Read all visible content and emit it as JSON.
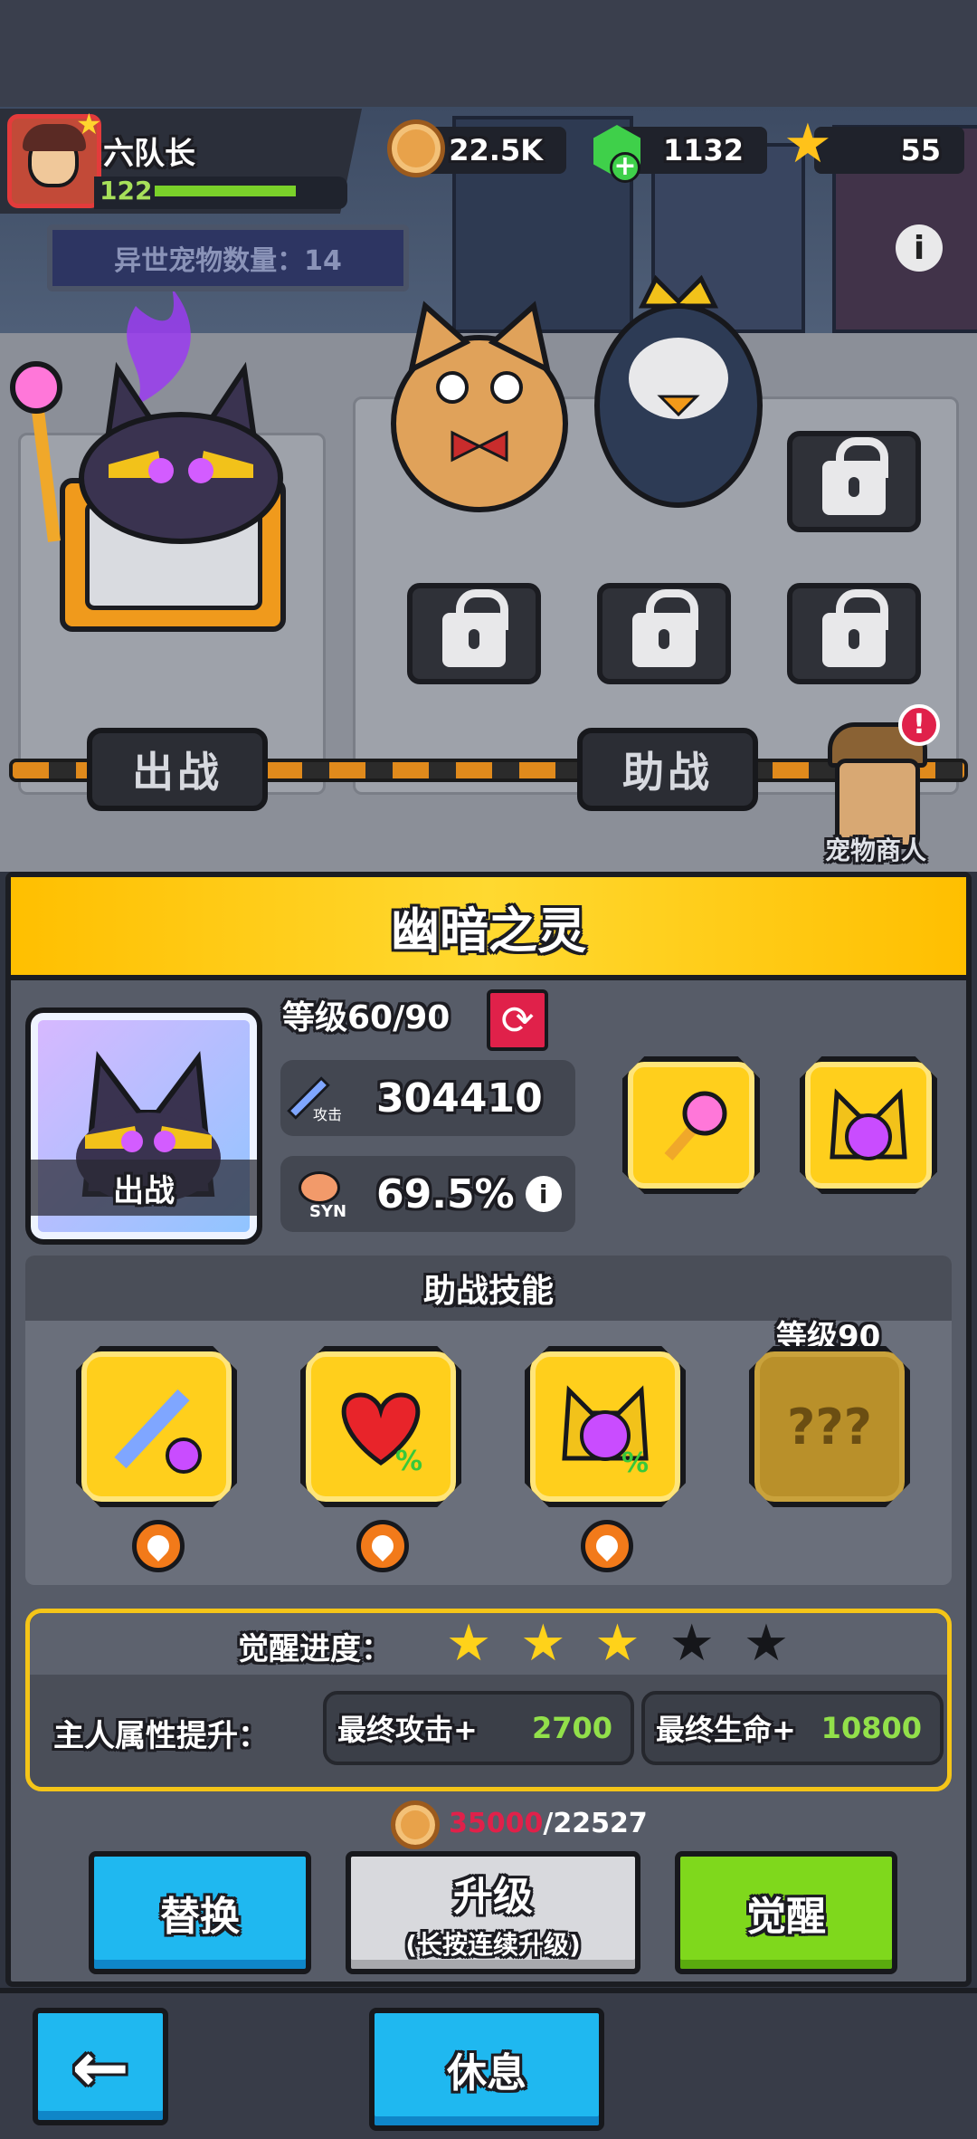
{
  "player": {
    "name": "六队长",
    "level": "122",
    "xp_fraction": 0.85
  },
  "resources": {
    "coins": "22.5K",
    "gems": "1132",
    "stars": "55"
  },
  "scene": {
    "pet_count_label": "异世宠物数量：14",
    "battle_sign": "出战",
    "assist_sign": "助战",
    "merchant_label": "宠物商人"
  },
  "pet": {
    "name": "幽暗之灵",
    "level_text": "等级60/90",
    "state_label": "出战",
    "attack_label": "攻击",
    "attack": "304410",
    "syn_label": "SYN",
    "synergy": "69.5%"
  },
  "skills": {
    "title": "助战技能",
    "locked_level": "等级90",
    "locked_text": "???"
  },
  "awaken": {
    "progress_label": "觉醒进度：",
    "stars_filled": 3,
    "stars_total": 5,
    "owner_label": "主人属性提升：",
    "attack_bonus_label": "最终攻击+",
    "attack_bonus": "2700",
    "hp_bonus_label": "最终生命+",
    "hp_bonus": "10800"
  },
  "cost": {
    "required": "35000",
    "owned": "/22527"
  },
  "buttons": {
    "replace": "替换",
    "upgrade": "升级",
    "upgrade_hint": "(长按连续升级)",
    "awaken": "觉醒",
    "back": "←",
    "rest": "休息"
  },
  "colors": {
    "banner": "#ffcf1c",
    "replace": "#1fb8f0",
    "awaken": "#7fd81c",
    "cost_red": "#e0214a"
  }
}
